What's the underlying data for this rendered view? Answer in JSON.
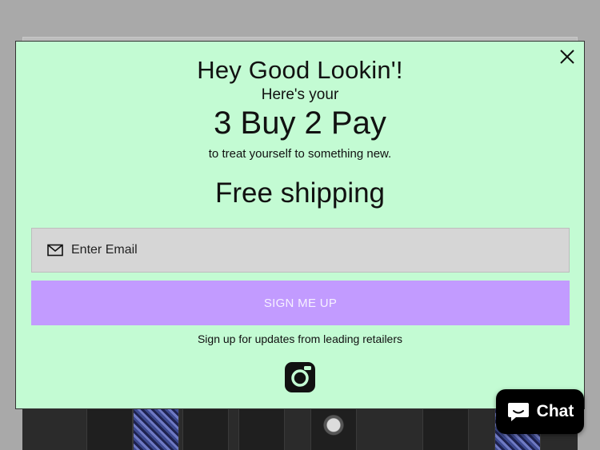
{
  "popup": {
    "headline": "Hey Good Lookin'!",
    "subline": "Here's your",
    "offer": "3 Buy 2 Pay",
    "tagline": "to treat yourself to something new.",
    "shipping": "Free shipping",
    "email_placeholder": "Enter Email",
    "submit_label": "SIGN ME UP",
    "disclaimer": "Sign up for updates from leading retailers"
  },
  "chat": {
    "label": "Chat"
  },
  "colors": {
    "modal_bg": "#c3fbd3",
    "button_bg": "#c29bff",
    "input_bg": "#d6d6d6"
  },
  "icons": [
    "close-icon",
    "mail-icon",
    "instagram-icon",
    "chat-bubble-icon"
  ]
}
